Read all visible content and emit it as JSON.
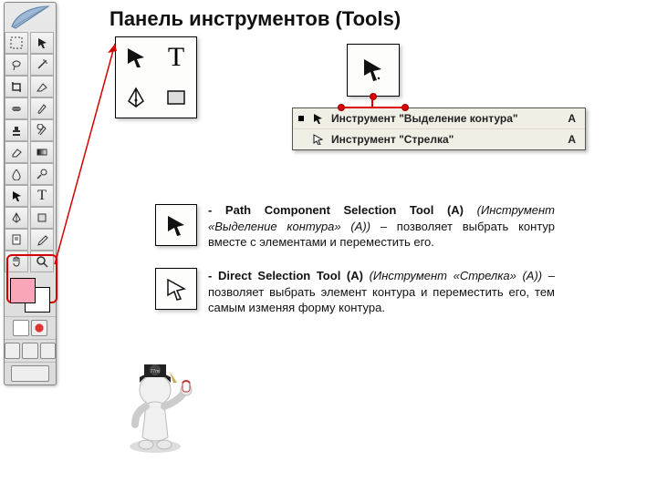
{
  "title": "Панель инструментов (Tools)",
  "menu": {
    "items": [
      {
        "label": "Инструмент \"Выделение контура\"",
        "key": "A",
        "active": true
      },
      {
        "label": "Инструмент \"Стрелка\"",
        "key": "A",
        "active": false
      }
    ]
  },
  "descriptions": {
    "path": {
      "bold": "- Path Component Selection Tool (A) ",
      "italic": "(Инструмент «Выделение контура» (A))",
      "rest": " – позволяет выбрать контур вместе с элементами и переместить его."
    },
    "direct": {
      "bold": "- Direct Selection Tool (A) ",
      "italic": "(Инструмент «Стрелка» (A))",
      "rest": " – позволяет выбрать элемент контура и переместить его, тем самым изменяя форму контура."
    }
  },
  "callout_a_cells": {
    "c1_icon": "path-selection-icon",
    "c2_text": "T",
    "c3_icon": "pen-icon",
    "c4_icon": "rectangle-icon"
  },
  "mascot_badge": "77mi",
  "colors": {
    "highlight": "#d80000",
    "fg_swatch": "#f9a6b8",
    "bg_swatch": "#ffffff"
  }
}
